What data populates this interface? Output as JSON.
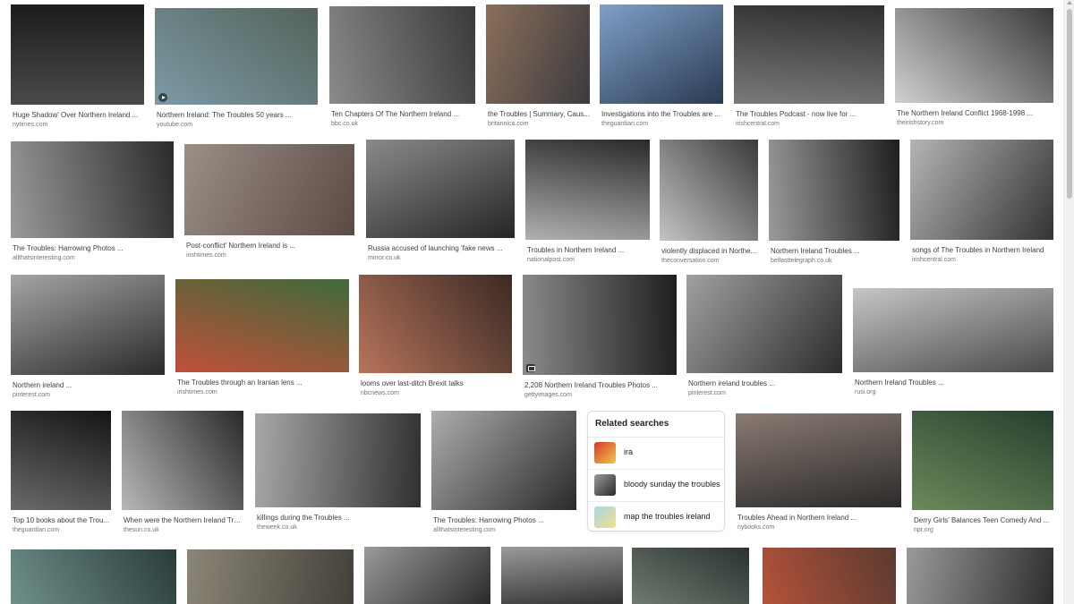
{
  "results": [
    {
      "title": "Huge Shadow' Over Northern Ireland ...",
      "source": "nytimes.com",
      "tone": [
        "#4a4a4a",
        "#1c1c1c"
      ],
      "badge": ""
    },
    {
      "title": "Northern Ireland: The Troubles 50 years ...",
      "source": "youtube.com",
      "tone": [
        "#7d9aa6",
        "#52635a"
      ],
      "badge": "play-icon"
    },
    {
      "title": "Ten Chapters Of The Northern Ireland ...",
      "source": "bbc.co.uk",
      "tone": [
        "#8a8a8a",
        "#3a3a3a"
      ],
      "badge": ""
    },
    {
      "title": "the Troubles | Summary, Caus...",
      "source": "britannica.com",
      "tone": [
        "#8b6f5a",
        "#3b3a3f"
      ],
      "badge": ""
    },
    {
      "title": "Investigations into the Troubles are ...",
      "source": "theguardian.com",
      "tone": [
        "#7fa0c8",
        "#2a3a52"
      ],
      "badge": ""
    },
    {
      "title": "The Troubles Podcast - now live for ...",
      "source": "irishcentral.com",
      "tone": [
        "#7a7a7a",
        "#2e2e2e"
      ],
      "badge": ""
    },
    {
      "title": "The Northern Ireland Conflict 1968-1998 ...",
      "source": "theirishstory.com",
      "tone": [
        "#d0d0d0",
        "#3a3a3a"
      ],
      "badge": ""
    },
    {
      "title": "The Troubles: Harrowing Photos ...",
      "source": "allthatsinteresting.com",
      "tone": [
        "#9a9a9a",
        "#2b2b2b"
      ],
      "badge": ""
    },
    {
      "title": "Post-conflict' Northern Ireland is ...",
      "source": "irishtimes.com",
      "tone": [
        "#9b8f86",
        "#5a4a44"
      ],
      "badge": ""
    },
    {
      "title": "Russia accused of launching 'fake news ...",
      "source": "mirror.co.uk",
      "tone": [
        "#8a8a8a",
        "#262626"
      ],
      "badge": ""
    },
    {
      "title": "Troubles in Northern Ireland ...",
      "source": "nationalpost.com",
      "tone": [
        "#b0b0b0",
        "#2a2a2a"
      ],
      "badge": ""
    },
    {
      "title": "violently displaced in Northe...",
      "source": "theconversation.com",
      "tone": [
        "#c4c4c4",
        "#3a3a3a"
      ],
      "badge": ""
    },
    {
      "title": "Northern Ireland Troubles ...",
      "source": "belfasttelegraph.co.uk",
      "tone": [
        "#9a9a9a",
        "#1e1e1e"
      ],
      "badge": ""
    },
    {
      "title": "songs of The Troubles in Northern Ireland",
      "source": "irishcentral.com",
      "tone": [
        "#b5b5b5",
        "#333333"
      ],
      "badge": ""
    },
    {
      "title": "Northern ireland ...",
      "source": "pinterest.com",
      "tone": [
        "#a5a5a5",
        "#2a2a2a"
      ],
      "badge": ""
    },
    {
      "title": "The Troubles through an Iranian lens ...",
      "source": "irishtimes.com",
      "tone": [
        "#c0503a",
        "#3f6a3a"
      ],
      "badge": ""
    },
    {
      "title": "looms over last-ditch Brexit talks",
      "source": "nbcnews.com",
      "tone": [
        "#b7735a",
        "#3a2a24"
      ],
      "badge": ""
    },
    {
      "title": "2,208 Northern Ireland Troubles Photos ...",
      "source": "gettyimages.com",
      "tone": [
        "#8a8a8a",
        "#1f1f1f"
      ],
      "badge": "gallery-icon"
    },
    {
      "title": "Northern ireland troubles ...",
      "source": "pinterest.com",
      "tone": [
        "#a0a0a0",
        "#2c2c2c"
      ],
      "badge": ""
    },
    {
      "title": "Northern Ireland Troubles ...",
      "source": "rusi.org",
      "tone": [
        "#c6c6c6",
        "#4a4a4a"
      ],
      "badge": ""
    },
    {
      "title": "Top 10 books about the Trou...",
      "source": "theguardian.com",
      "tone": [
        "#6a6a6a",
        "#151515"
      ],
      "badge": ""
    },
    {
      "title": "When were the Northern Ireland Tro...",
      "source": "thesun.co.uk",
      "tone": [
        "#b8b8b8",
        "#2a2a2a"
      ],
      "badge": ""
    },
    {
      "title": "killings during the Troubles ...",
      "source": "theweek.co.uk",
      "tone": [
        "#a8a8a8",
        "#303030"
      ],
      "badge": ""
    },
    {
      "title": "The Troubles: Harrowing Photos ...",
      "source": "allthatsinteresting.com",
      "tone": [
        "#adadad",
        "#2a2a2a"
      ],
      "badge": ""
    },
    {
      "title": "Troubles Ahead in Northern Ireland ...",
      "source": "nybooks.com",
      "tone": [
        "#8a7a72",
        "#2b2b2b"
      ],
      "badge": ""
    },
    {
      "title": "Derry Girls' Balances Teen Comedy And ...",
      "source": "npr.org",
      "tone": [
        "#6b8a5a",
        "#24402e"
      ],
      "badge": ""
    },
    {
      "title": "",
      "source": "",
      "tone": [
        "#6f8f8a",
        "#2a3c3a"
      ],
      "badge": ""
    },
    {
      "title": "",
      "source": "",
      "tone": [
        "#8b8676",
        "#43403a"
      ],
      "badge": ""
    },
    {
      "title": "",
      "source": "",
      "tone": [
        "#9a9a9a",
        "#2a2a2a"
      ],
      "badge": ""
    },
    {
      "title": "",
      "source": "",
      "tone": [
        "#9a9a9a",
        "#333333"
      ],
      "badge": ""
    },
    {
      "title": "",
      "source": "",
      "tone": [
        "#6f7a70",
        "#2a3330"
      ],
      "badge": ""
    },
    {
      "title": "",
      "source": "",
      "tone": [
        "#b5523a",
        "#5a3a30"
      ],
      "badge": ""
    },
    {
      "title": "",
      "source": "",
      "tone": [
        "#9a9a9a",
        "#2c2c2c"
      ],
      "badge": ""
    }
  ],
  "related_searches": {
    "heading": "Related searches",
    "items": [
      {
        "label": "ira",
        "tone": [
          "#d43a2a",
          "#f2c74a"
        ]
      },
      {
        "label": "bloody sunday the troubles",
        "tone": [
          "#9a9a9a",
          "#2a2a2a"
        ]
      },
      {
        "label": "map the troubles ireland",
        "tone": [
          "#a8d6e8",
          "#f0e08a"
        ]
      }
    ]
  },
  "colors": {
    "title_text": "#3c4043",
    "source_text": "#70757a",
    "card_border": "#dadce0"
  }
}
